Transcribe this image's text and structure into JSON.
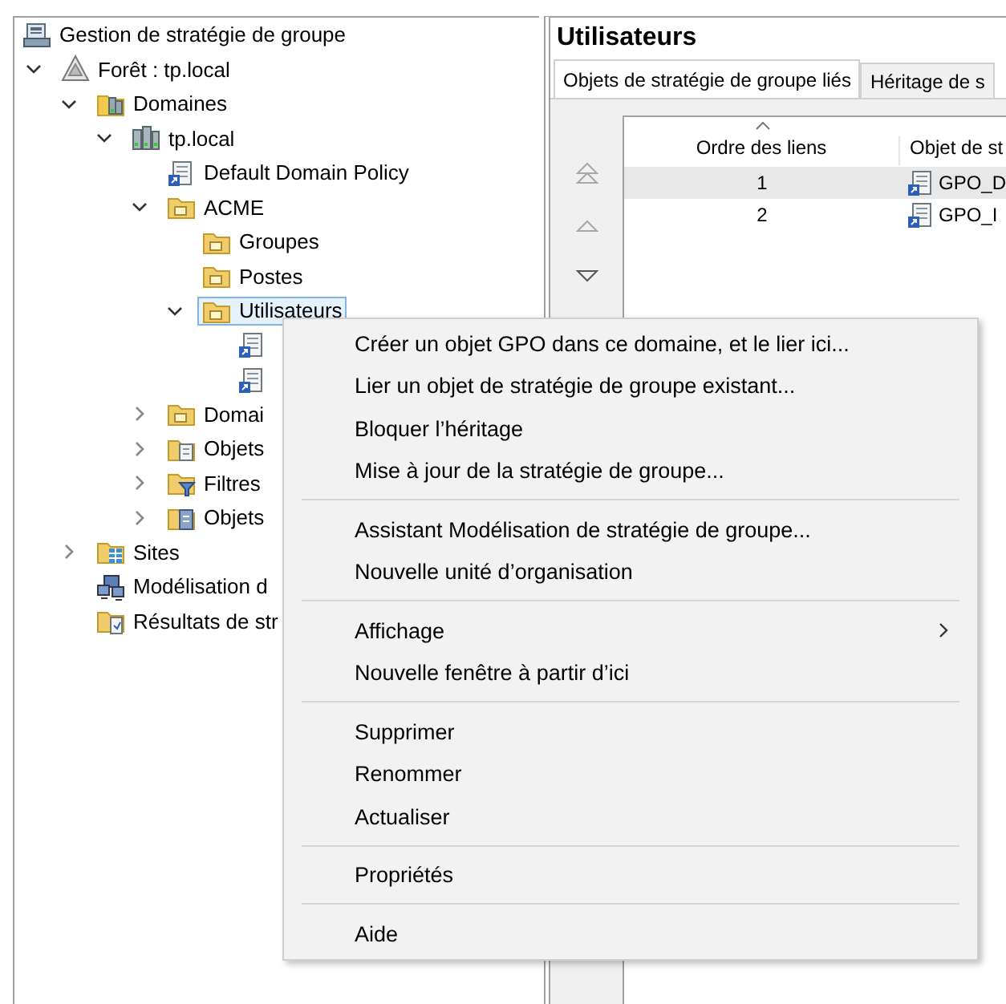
{
  "tree": [
    {
      "label": "Gestion de stratégie de groupe",
      "kind": "console",
      "selected": false,
      "children": [
        {
          "label": "Forêt : tp.local",
          "kind": "forest",
          "expanded": true,
          "selected": false,
          "children": [
            {
              "label": "Domaines",
              "kind": "domains",
              "expanded": true,
              "selected": false,
              "children": [
                {
                  "label": "tp.local",
                  "kind": "domain",
                  "expanded": true,
                  "selected": false,
                  "children": [
                    {
                      "label": "Default Domain Policy",
                      "kind": "gpo",
                      "selected": false
                    },
                    {
                      "label": "ACME",
                      "kind": "ou",
                      "expanded": true,
                      "selected": false,
                      "children": [
                        {
                          "label": "Groupes",
                          "kind": "ou",
                          "selected": false
                        },
                        {
                          "label": "Postes",
                          "kind": "ou",
                          "selected": false
                        },
                        {
                          "label": "Utilisateurs",
                          "kind": "ou",
                          "expanded": true,
                          "selected": true,
                          "children": [
                            {
                              "kind": "gpo",
                              "selected": false
                            },
                            {
                              "kind": "gpo",
                              "selected": false
                            }
                          ]
                        }
                      ]
                    },
                    {
                      "label": "Domai",
                      "kind": "ou",
                      "expanded": false,
                      "selected": false
                    },
                    {
                      "label": "Objets",
                      "kind": "gpo-folder",
                      "expanded": false,
                      "selected": false
                    },
                    {
                      "label": "Filtres",
                      "kind": "wmi-folder",
                      "expanded": false,
                      "selected": false
                    },
                    {
                      "label": "Objets",
                      "kind": "starter-folder",
                      "expanded": false,
                      "selected": false
                    }
                  ]
                }
              ]
            },
            {
              "label": "Sites",
              "kind": "sites",
              "expanded": false,
              "selected": false
            },
            {
              "label": "Modélisation d",
              "kind": "modeling",
              "selected": false
            },
            {
              "label": "Résultats de str",
              "kind": "results",
              "selected": false
            }
          ]
        }
      ]
    }
  ],
  "details": {
    "title": "Utilisateurs",
    "tabs": [
      {
        "label": "Objets de stratégie de groupe liés",
        "selected": true
      },
      {
        "label": "Héritage de s",
        "selected": false
      }
    ],
    "order_buttons": [
      {
        "kind": "top",
        "disabled": true
      },
      {
        "kind": "up",
        "disabled": true
      },
      {
        "kind": "down",
        "disabled": false
      }
    ],
    "table": {
      "columns": [
        "Ordre des liens",
        "Objet de st"
      ],
      "rows": [
        {
          "cells": [
            "1",
            "GPO_D"
          ],
          "selected": true
        },
        {
          "cells": [
            "2",
            "GPO_I"
          ],
          "selected": false
        }
      ]
    }
  },
  "context_menu": [
    {
      "kind": "item",
      "label": "Créer un objet GPO dans ce domaine, et le lier ici..."
    },
    {
      "kind": "item",
      "label": "Lier un objet de stratégie de groupe existant..."
    },
    {
      "kind": "item",
      "label": "Bloquer l’héritage"
    },
    {
      "kind": "item",
      "label": "Mise à jour de la stratégie de groupe..."
    },
    {
      "kind": "separator"
    },
    {
      "kind": "item",
      "label": "Assistant Modélisation de stratégie de groupe..."
    },
    {
      "kind": "item",
      "label": "Nouvelle unité d’organisation"
    },
    {
      "kind": "separator"
    },
    {
      "kind": "item",
      "label": "Affichage",
      "submenu": true
    },
    {
      "kind": "item",
      "label": "Nouvelle fenêtre à partir d’ici"
    },
    {
      "kind": "separator"
    },
    {
      "kind": "item",
      "label": "Supprimer"
    },
    {
      "kind": "item",
      "label": "Renommer"
    },
    {
      "kind": "item",
      "label": "Actualiser"
    },
    {
      "kind": "separator"
    },
    {
      "kind": "item",
      "label": "Propriétés"
    },
    {
      "kind": "separator"
    },
    {
      "kind": "item",
      "label": "Aide"
    }
  ]
}
